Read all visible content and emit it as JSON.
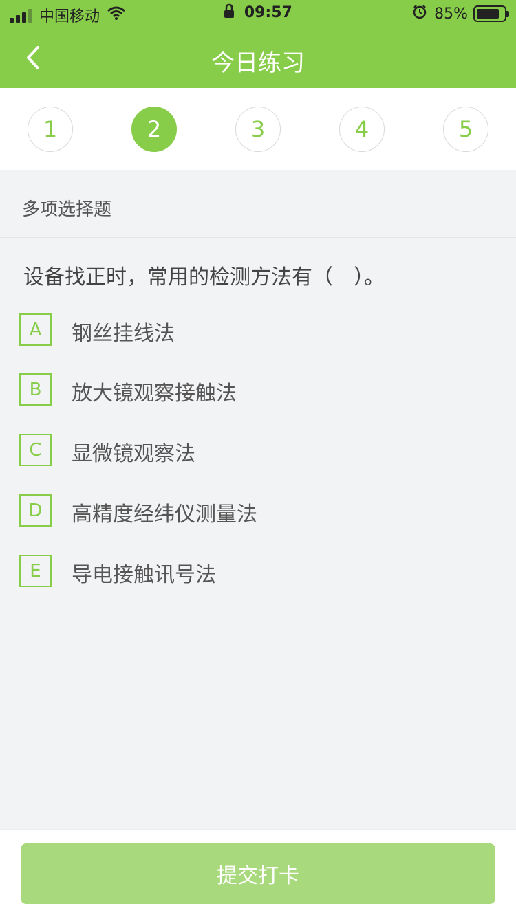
{
  "status": {
    "carrier": "中国移动",
    "time": "09:57",
    "battery": "85%",
    "battery_level": 0.85
  },
  "nav": {
    "title": "今日练习"
  },
  "steps": [
    "1",
    "2",
    "3",
    "4",
    "5"
  ],
  "active_step": "2",
  "question": {
    "type": "多项选择题",
    "text": "设备找正时，常用的检测方法有（　）。",
    "options": [
      {
        "key": "A",
        "text": "钢丝挂线法"
      },
      {
        "key": "B",
        "text": "放大镜观察接触法"
      },
      {
        "key": "C",
        "text": "显微镜观察法"
      },
      {
        "key": "D",
        "text": "高精度经纬仪测量法"
      },
      {
        "key": "E",
        "text": "导电接触讯号法"
      }
    ]
  },
  "submit_label": "提交打卡",
  "colors": {
    "accent": "#87cd4a",
    "submit_bg": "#a8d97c",
    "page_bg": "#f2f3f5"
  }
}
